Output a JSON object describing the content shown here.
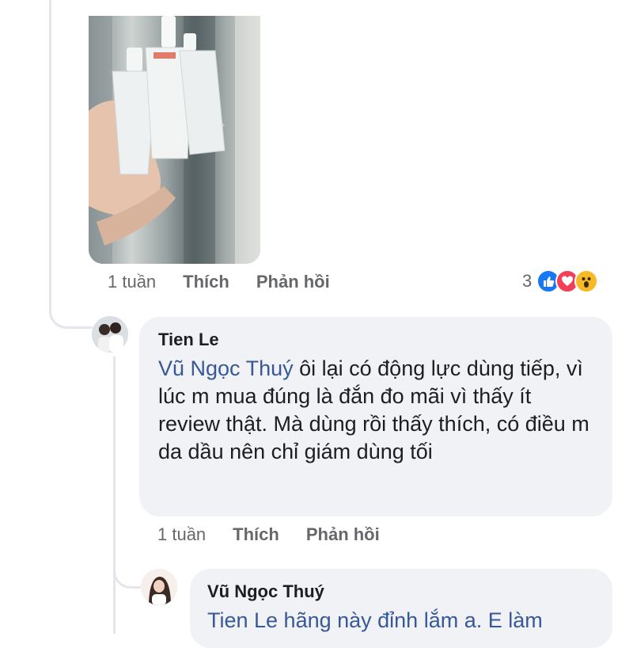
{
  "post": {
    "photo": {
      "description_icon": "product-bottles-photo"
    },
    "actions": {
      "time": "1 tuần",
      "like": "Thích",
      "reply": "Phản hồi"
    },
    "reactions": {
      "count": "3",
      "types": [
        "like-icon",
        "love-icon",
        "wow-icon"
      ],
      "colors": {
        "like": "#1877f2",
        "love": "#f33e58",
        "wow": "#f7b928"
      }
    }
  },
  "comment1": {
    "author": "Tien Le",
    "mention": "Vũ Ngọc Thuý",
    "text": " ôi lại có động lực dùng tiếp, vì lúc m mua đúng là đắn đo mãi vì thấy ít review thật. Mà dùng rồi thấy thích, có điều m da dầu nên chỉ giám dùng tối",
    "actions": {
      "time": "1 tuần",
      "like": "Thích",
      "reply": "Phản hồi"
    }
  },
  "comment2": {
    "author": "Vũ Ngọc Thuý",
    "partial_text": "Tien Le  hãng này đỉnh lắm a. E làm"
  },
  "colors": {
    "mention": "#385898",
    "bubble": "#f0f2f5",
    "meta": "#65676b"
  }
}
